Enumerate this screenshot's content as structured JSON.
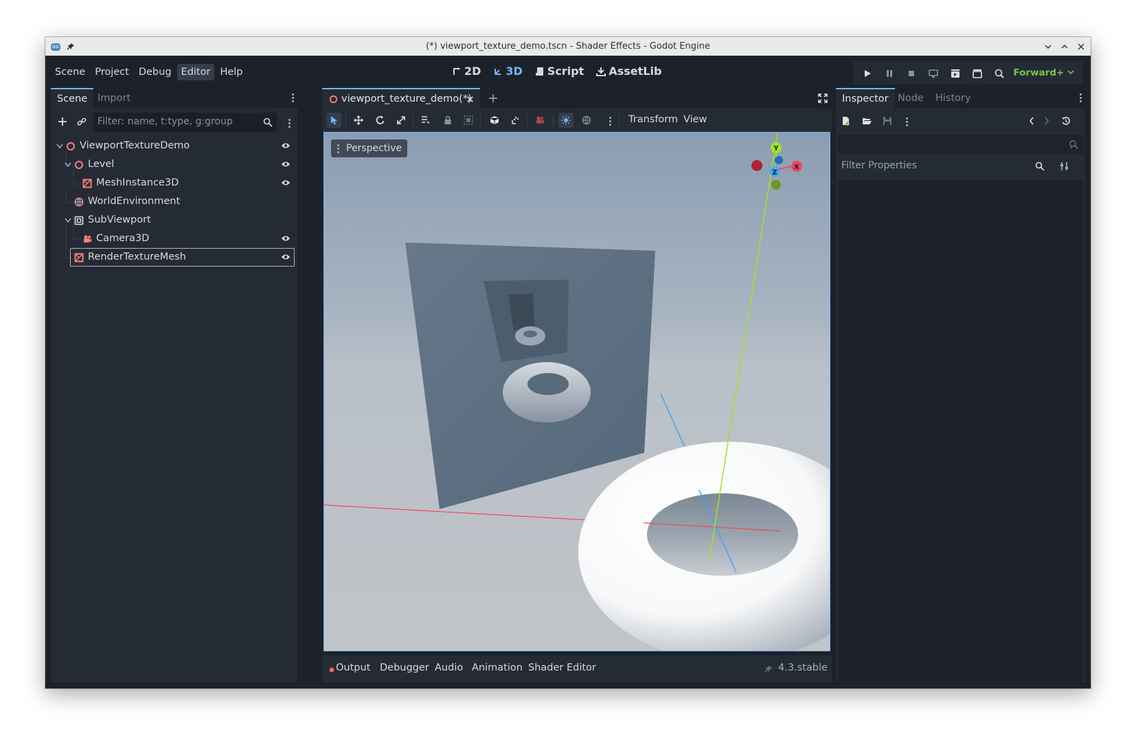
{
  "window": {
    "title": "(*) viewport_texture_demo.tscn - Shader Effects - Godot Engine"
  },
  "menu": [
    "Scene",
    "Project",
    "Debug",
    "Editor",
    "Help"
  ],
  "menu_active": "Editor",
  "modes": [
    {
      "label": "2D",
      "icon": "2d-icon"
    },
    {
      "label": "3D",
      "icon": "3d-icon"
    },
    {
      "label": "Script",
      "icon": "script-icon"
    },
    {
      "label": "AssetLib",
      "icon": "assetlib-icon"
    }
  ],
  "mode_active": "3D",
  "renderer": "Forward+",
  "scene_dock": {
    "tabs": [
      "Scene",
      "Import"
    ],
    "filter_placeholder": "Filter: name, t:type, g:group",
    "tree": [
      {
        "name": "ViewportTextureDemo",
        "icon": "node3d-icon",
        "depth": 0,
        "expanded": true,
        "visible_toggle": true
      },
      {
        "name": "Level",
        "icon": "node3d-icon",
        "depth": 1,
        "expanded": true,
        "visible_toggle": true
      },
      {
        "name": "MeshInstance3D",
        "icon": "meshinstance-icon",
        "depth": 2,
        "visible_toggle": true
      },
      {
        "name": "WorldEnvironment",
        "icon": "worldenvironment-icon",
        "depth": 1,
        "visible_toggle": false
      },
      {
        "name": "SubViewport",
        "icon": "subviewport-icon",
        "depth": 1,
        "expanded": true,
        "visible_toggle": false
      },
      {
        "name": "Camera3D",
        "icon": "camera-icon",
        "depth": 2,
        "visible_toggle": true
      },
      {
        "name": "RenderTextureMesh",
        "icon": "meshinstance-icon",
        "depth": 1,
        "visible_toggle": true,
        "selected": true
      }
    ]
  },
  "editor": {
    "scene_tab": "viewport_texture_demo(*)",
    "toolbar_menus": [
      "Transform",
      "View"
    ],
    "viewport_label": "Perspective",
    "gizmo_axes": [
      "Y",
      "X",
      "Z"
    ]
  },
  "bottom_panel": {
    "tabs": [
      "Output",
      "Debugger",
      "Audio",
      "Animation",
      "Shader Editor"
    ],
    "version": "4.3.stable"
  },
  "inspector": {
    "tabs": [
      "Inspector",
      "Node",
      "History"
    ],
    "filter_placeholder": "Filter Properties"
  },
  "colors": {
    "accent": "#6fb8ff",
    "renderer": "#79c24a",
    "node3d": "#fc7f7f",
    "axis_x": "#f0475d",
    "axis_y": "#9ee51f",
    "axis_z": "#3da5ff"
  }
}
